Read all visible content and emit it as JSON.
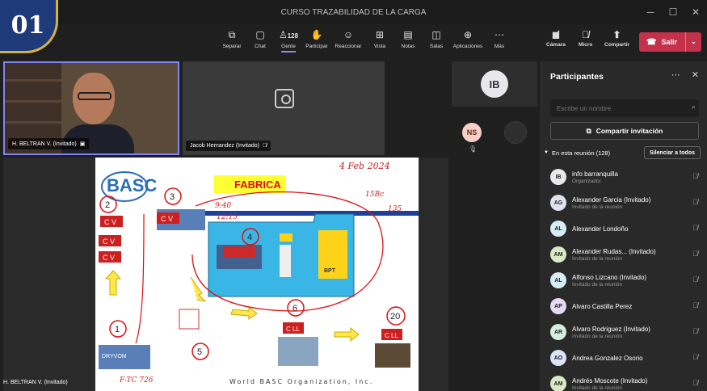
{
  "window": {
    "title": "CURSO TRAZABILIDAD DE LA CARGA"
  },
  "badge": "01",
  "toolbar": {
    "items": [
      {
        "label": "Separar",
        "icon": "pop-out-icon"
      },
      {
        "label": "Chat",
        "icon": "chat-icon"
      },
      {
        "label": "Gente",
        "icon": "people-icon",
        "count": "128"
      },
      {
        "label": "Participar",
        "icon": "raise-hand-icon"
      },
      {
        "label": "Reaccionar",
        "icon": "react-icon"
      },
      {
        "label": "Vista",
        "icon": "view-icon"
      },
      {
        "label": "Notas",
        "icon": "notes-icon"
      },
      {
        "label": "Salas",
        "icon": "rooms-icon"
      },
      {
        "label": "Aplicaciones",
        "icon": "apps-icon"
      },
      {
        "label": "Más",
        "icon": "more-icon"
      }
    ],
    "camera_label": "Cámara",
    "mic_label": "Micro",
    "share_label": "Compartir",
    "leave_label": "Salir"
  },
  "videos": {
    "tile1_name": "H. BELTRAN V. (Invitado)",
    "tile2_name": "Jacob Hernandez (Invitado)",
    "side_avatar": "IB",
    "ns_avatar": "NS",
    "share_name": "H. BELTRAN V. (Invitado)"
  },
  "slide": {
    "logo": "BASC",
    "factory_label": "FABRICA",
    "handwritten_date": "4 Feb 2024",
    "handwritten_time1": "9:40",
    "handwritten_time2": "12:15",
    "handwritten_15": "15Bc",
    "handwritten_135": "135",
    "handwritten_ftc": "F-TC 726",
    "cv_labels": [
      "C V",
      "C V",
      "C V",
      "C V"
    ],
    "cll_labels": [
      "C LL",
      "C LL"
    ],
    "bpt_label": "BPT",
    "circled_numbers": [
      "1",
      "2",
      "3",
      "4",
      "5",
      "6",
      "20"
    ],
    "truck_text": "DRYVOM",
    "footer": "World BASC Organization, Inc."
  },
  "panel": {
    "title": "Participantes",
    "search_placeholder": "Escribe un nombre",
    "invite_label": "Compartir invitación",
    "section_label": "En esta reunión (128)",
    "mute_all_label": "Silenciar a todos",
    "participants": [
      {
        "initials": "IB",
        "name": "info barranquilla",
        "role": "Organizador",
        "color": "#e8e8ec"
      },
      {
        "initials": "AG",
        "name": "Alexander Garcia (Invitado)",
        "role": "Invitado de la reunión",
        "color": "#dfe3f0"
      },
      {
        "initials": "AL",
        "name": "Alexander Londoño",
        "role": "",
        "color": "#d7ecf5"
      },
      {
        "initials": "AM",
        "name": "Alexander Rudas... (Invitado)",
        "role": "Invitado de la reunión",
        "color": "#dbe8c6"
      },
      {
        "initials": "AL",
        "name": "Alfonso Lizcano (Invitado)",
        "role": "Invitado de la reunión",
        "color": "#d7ecf5"
      },
      {
        "initials": "AP",
        "name": "Alvaro Castilla Perez",
        "role": "",
        "color": "#e6d9f2"
      },
      {
        "initials": "AR",
        "name": "Alvaro Rodriguez (Invitado)",
        "role": "Invitado de la reunión",
        "color": "#d6eee1"
      },
      {
        "initials": "AO",
        "name": "Andrea Gonzalez Osorio",
        "role": "",
        "color": "#dbe4f7"
      },
      {
        "initials": "AM",
        "name": "Andrés Moscote (Invitado)",
        "role": "Invitado de la reunión",
        "color": "#dbe8c6"
      }
    ]
  }
}
